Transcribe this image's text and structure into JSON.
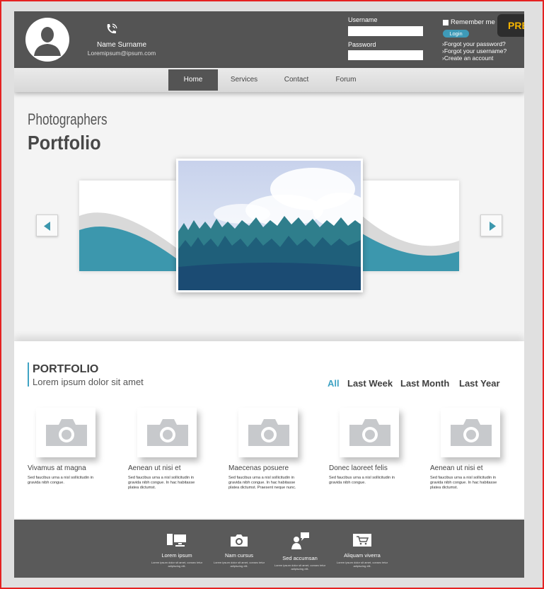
{
  "header": {
    "profile_name": "Name Surname",
    "profile_email": "Loremipsum@ipsum.com",
    "username_label": "Username",
    "password_label": "Password",
    "remember_label": "Remember me",
    "login_label": "Login",
    "links": [
      "Forgot your password?",
      "Forgot your username?",
      "Create an account"
    ],
    "premium_badge": "PREMI"
  },
  "nav": {
    "items": [
      "Home",
      "Services",
      "Contact",
      "Forum"
    ],
    "active": "Home"
  },
  "hero": {
    "title_line1": "Photographers",
    "title_line2": "Portfolio"
  },
  "portfolio": {
    "heading": "PORTFOLIO",
    "subheading": "Lorem ipsum dolor sit amet",
    "filters": [
      "All",
      "Last Week",
      "Last Month",
      "Last Year"
    ],
    "selected_filter": "All",
    "items": [
      {
        "title": "Vivamus at magna",
        "text": "Sed faucibus urna a nisl sollicitudin in gravida nibh congue."
      },
      {
        "title": "Aenean ut nisi et",
        "text": "Sed faucibus urna a nisl sollicitudin in gravida nibh congue. In hac habitasse platea dictumst."
      },
      {
        "title": "Maecenas posuere",
        "text": "Sed faucibus urna a nisl sollicitudin in gravida nibh congue. In hac habitasse platea dictumst. Praesent neque nunc."
      },
      {
        "title": "Donec laoreet felis",
        "text": "Sed faucibus urna a nisl sollicitudin in gravida nibh congue."
      },
      {
        "title": "Aenean ut nisi et",
        "text": "Sed faucibus urna a nisl sollicitudin in gravida nibh congue. In hac habitasse platea dictumst."
      }
    ]
  },
  "footer": {
    "items": [
      {
        "label": "Lorem ipsum",
        "icon": "devices-icon",
        "text": "Lorem ipsum dolor sit amet, consec tetur adipiscing elit."
      },
      {
        "label": "Nam cursus",
        "icon": "camera-icon",
        "text": "Lorem ipsum dolor sit amet, consec tetur adipiscing elit."
      },
      {
        "label": "Sed accumsan",
        "icon": "chat-person-icon",
        "text": "Lorem ipsum dolor sit amet, consec tetur adipiscing elit."
      },
      {
        "label": "Aliquam viverra",
        "icon": "cart-icon",
        "text": "Lorem ipsum dolor sit amet, consec tetur adipiscing elit."
      }
    ]
  },
  "colors": {
    "header_bg": "#545454",
    "accent": "#3fa3c4",
    "badge": "#f5b400"
  }
}
